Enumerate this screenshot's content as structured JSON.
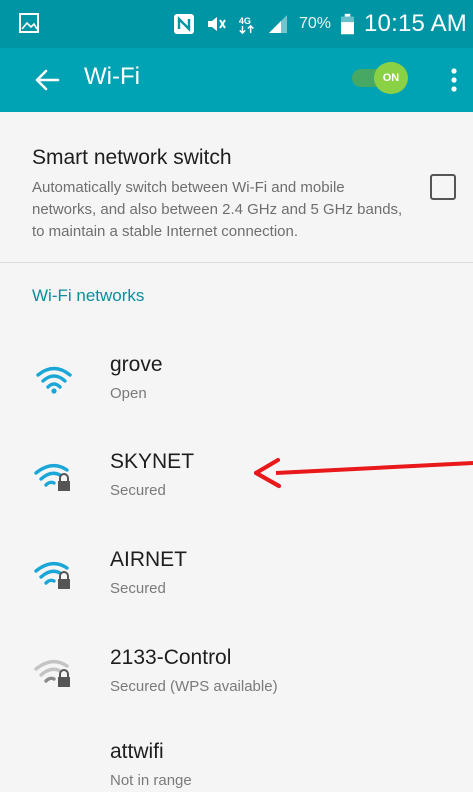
{
  "status_bar": {
    "battery_percent": "70%",
    "time": "10:15 AM"
  },
  "app_bar": {
    "title": "Wi-Fi",
    "toggle_label": "ON",
    "wifi_enabled": true
  },
  "smart_network_switch": {
    "title": "Smart network switch",
    "description": "Automatically switch between Wi-Fi and mobile networks, and also between 2.4 GHz and 5 GHz bands, to maintain a stable Internet connection.",
    "checked": false
  },
  "networks_section": {
    "header": "Wi-Fi networks",
    "items": [
      {
        "name": "grove",
        "status": "Open",
        "icon": "wifi-signal-icon",
        "secured": false
      },
      {
        "name": "SKYNET",
        "status": "Secured",
        "icon": "wifi-secured-icon",
        "secured": true
      },
      {
        "name": "AIRNET",
        "status": "Secured",
        "icon": "wifi-secured-icon",
        "secured": true
      },
      {
        "name": "2133-Control",
        "status": "Secured (WPS available)",
        "icon": "wifi-secured-weak-icon",
        "secured": true
      },
      {
        "name": "attwifi",
        "status": "Not in range",
        "icon": "",
        "secured": false
      }
    ]
  },
  "colors": {
    "status_bar": "#0095a5",
    "app_bar": "#00a3b4",
    "accent": "#0a8e9c",
    "toggle_on": "#8bd145",
    "wifi_icon": "#1aa6d6",
    "annotation_arrow": "#e8181b"
  }
}
